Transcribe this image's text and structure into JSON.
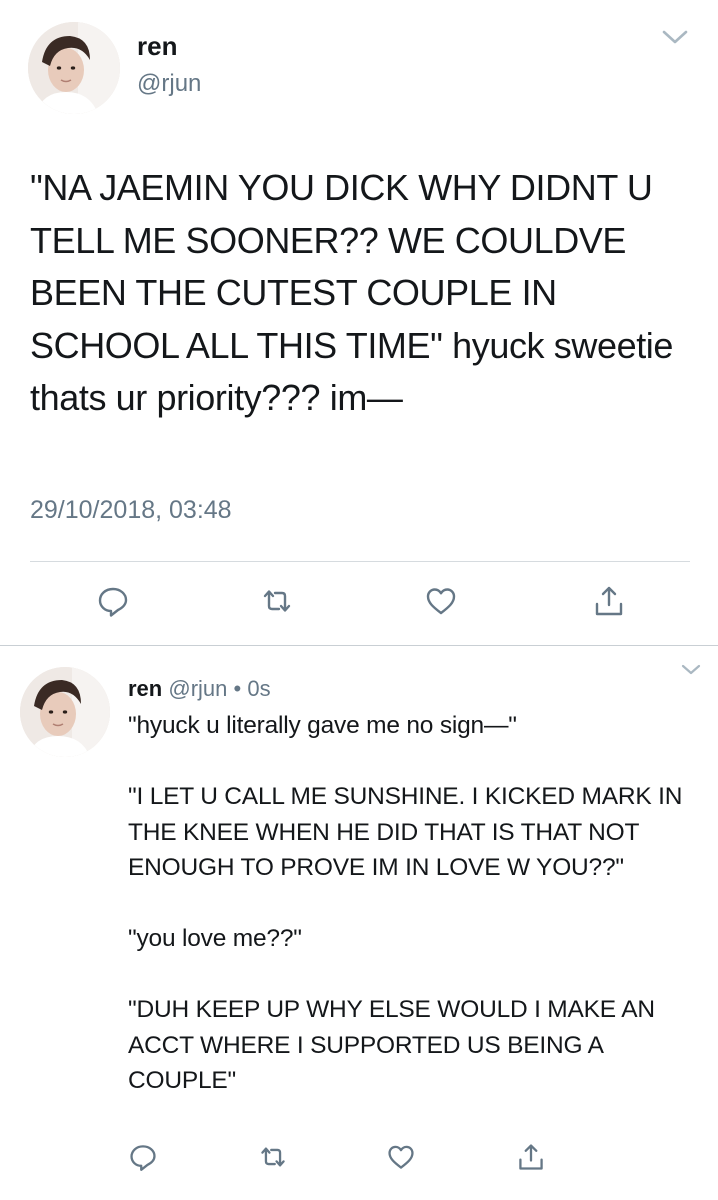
{
  "tweet_main": {
    "name": "ren",
    "handle": "@rjun",
    "text": "\"NA JAEMIN YOU DICK WHY DIDNT U TELL ME SOONER?? WE COULDVE BEEN THE CUTEST COUPLE IN SCHOOL ALL THIS TIME\" hyuck sweetie thats ur priority??? im—",
    "timestamp": "29/10/2018, 03:48",
    "actions": [
      "reply-icon",
      "retweet-icon",
      "like-icon",
      "share-icon"
    ]
  },
  "tweet_reply": {
    "name": "ren",
    "handle": "@rjun",
    "separator": "•",
    "age": "0s",
    "text": "\"hyuck u literally gave me no sign—\"\n\n\"I LET U CALL ME SUNSHINE. I KICKED MARK IN THE KNEE WHEN HE DID THAT IS THAT NOT ENOUGH TO PROVE IM IN LOVE W YOU??\"\n\n\"you love me??\"\n\n\"DUH KEEP UP WHY ELSE WOULD I MAKE AN ACCT WHERE I SUPPORTED US BEING A COUPLE\"",
    "actions": [
      "reply-icon",
      "retweet-icon",
      "like-icon",
      "share-icon"
    ]
  },
  "colors": {
    "text": "#14171a",
    "secondary": "#657786",
    "icon": "#657786",
    "divider": "#d6dbdf",
    "background": "#ffffff"
  }
}
